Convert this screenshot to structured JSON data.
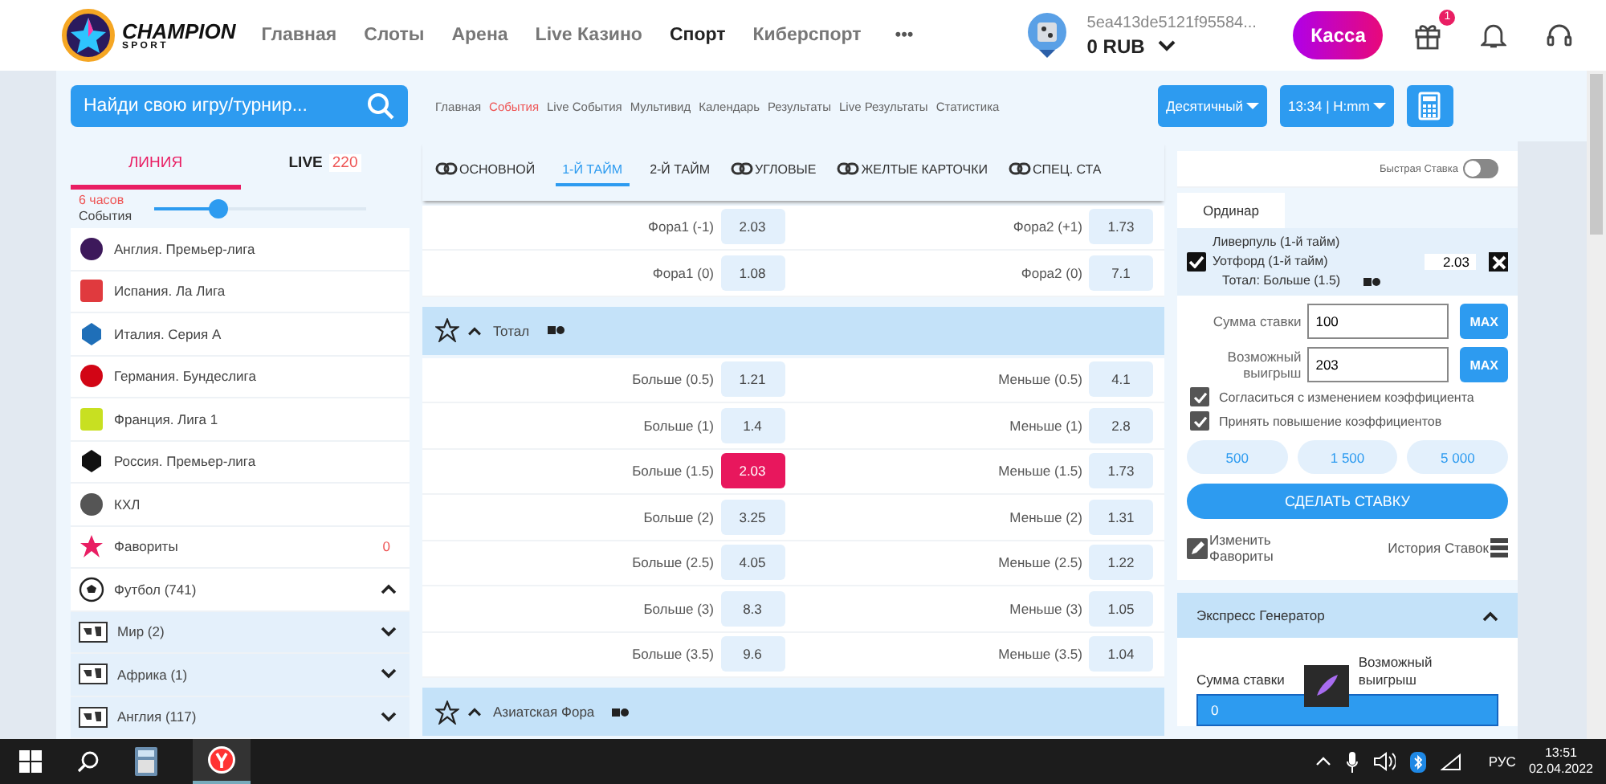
{
  "header": {
    "logo": {
      "title": "CHAMPION",
      "subtitle": "S P O R T"
    },
    "nav": [
      {
        "label": "Главная",
        "selected": false
      },
      {
        "label": "Слоты",
        "selected": false
      },
      {
        "label": "Арена",
        "selected": false
      },
      {
        "label": "Live Казино",
        "selected": false
      },
      {
        "label": "Спорт",
        "selected": true
      },
      {
        "label": "Киберспорт",
        "selected": false
      }
    ],
    "more": "•••",
    "account": {
      "id": "5ea413de5121f95584...",
      "balance": "0 RUB"
    },
    "cashier": "Касса",
    "gift_badge": "1"
  },
  "subnav": {
    "search": {
      "placeholder": "Найди свою игру/турнир..."
    },
    "breadcrumbs": [
      {
        "label": "Главная",
        "selected": false
      },
      {
        "label": "События",
        "selected": true
      },
      {
        "label": "Live События",
        "selected": false
      },
      {
        "label": "Мультивид",
        "selected": false
      },
      {
        "label": "Календарь",
        "selected": false
      },
      {
        "label": "Результаты",
        "selected": false
      },
      {
        "label": "Live Результаты",
        "selected": false
      },
      {
        "label": "Статистика",
        "selected": false
      }
    ],
    "odds_format": "Десятичный",
    "time_format": "13:34 | H:mm"
  },
  "sidebar": {
    "tabs": [
      {
        "label": "ЛИНИЯ",
        "selected": true
      },
      {
        "label": "LIVE",
        "count": "220",
        "selected": false
      }
    ],
    "filter": {
      "hours": "6 часов",
      "label": "События",
      "level": 0.3
    },
    "items": [
      {
        "kind": "league",
        "name": "Англия. Премьер-лига"
      },
      {
        "kind": "league",
        "name": "Испания. Ла Лига"
      },
      {
        "kind": "league",
        "name": "Италия. Серия А"
      },
      {
        "kind": "league",
        "name": "Германия. Бундеслига"
      },
      {
        "kind": "league",
        "name": "Франция. Лига 1"
      },
      {
        "kind": "league",
        "name": "Россия. Премьер-лига"
      },
      {
        "kind": "league",
        "name": "КХЛ"
      },
      {
        "kind": "favorites",
        "name": "Фавориты",
        "count": "0"
      },
      {
        "kind": "sport",
        "name": "Футбол (741)",
        "expanded": true,
        "children": [
          {
            "name": "Мир (2)",
            "expanded": false
          },
          {
            "name": "Африка (1)",
            "expanded": false
          },
          {
            "name": "Англия (117)",
            "expanded": false
          }
        ]
      }
    ]
  },
  "markets": {
    "tabs": [
      {
        "label": "ОСНОВНОЙ",
        "linked": true,
        "selected": false
      },
      {
        "label": "1-Й ТАЙМ",
        "linked": false,
        "selected": true
      },
      {
        "label": "2-Й ТАЙМ",
        "linked": false,
        "selected": false
      },
      {
        "label": "УГЛОВЫЕ",
        "linked": true,
        "selected": false
      },
      {
        "label": "ЖЕЛТЫЕ КАРТОЧКИ",
        "linked": true,
        "selected": false
      },
      {
        "label": "СПЕЦ. СТА",
        "linked": true,
        "selected": false
      }
    ],
    "groups": [
      {
        "rows": [
          {
            "left": {
              "label": "Фора1 (-1)",
              "odds": "2.03",
              "selected": false
            },
            "right": {
              "label": "Фора2 (+1)",
              "odds": "1.73",
              "selected": false
            }
          },
          {
            "left": {
              "label": "Фора1 (0)",
              "odds": "1.08",
              "selected": false
            },
            "right": {
              "label": "Фора2 (0)",
              "odds": "7.1",
              "selected": false
            }
          }
        ]
      },
      {
        "title": "Тотал",
        "favorite": false,
        "expanded": true,
        "rows": [
          {
            "left": {
              "label": "Больше (0.5)",
              "odds": "1.21",
              "selected": false
            },
            "right": {
              "label": "Меньше (0.5)",
              "odds": "4.1",
              "selected": false
            }
          },
          {
            "left": {
              "label": "Больше (1)",
              "odds": "1.4",
              "selected": false
            },
            "right": {
              "label": "Меньше (1)",
              "odds": "2.8",
              "selected": false
            }
          },
          {
            "left": {
              "label": "Больше (1.5)",
              "odds": "2.03",
              "selected": true
            },
            "right": {
              "label": "Меньше (1.5)",
              "odds": "1.73",
              "selected": false
            }
          },
          {
            "left": {
              "label": "Больше (2)",
              "odds": "3.25",
              "selected": false
            },
            "right": {
              "label": "Меньше (2)",
              "odds": "1.31",
              "selected": false
            }
          },
          {
            "left": {
              "label": "Больше (2.5)",
              "odds": "4.05",
              "selected": false
            },
            "right": {
              "label": "Меньше (2.5)",
              "odds": "1.22",
              "selected": false
            }
          },
          {
            "left": {
              "label": "Больше (3)",
              "odds": "8.3",
              "selected": false
            },
            "right": {
              "label": "Меньше (3)",
              "odds": "1.05",
              "selected": false
            }
          },
          {
            "left": {
              "label": "Больше (3.5)",
              "odds": "9.6",
              "selected": false
            },
            "right": {
              "label": "Меньше (3.5)",
              "odds": "1.04",
              "selected": false
            }
          }
        ]
      },
      {
        "title": "Азиатская Фора",
        "favorite": false,
        "expanded": true
      }
    ]
  },
  "betslip": {
    "quick_bet": {
      "label": "Быстрая Ставка",
      "on": false
    },
    "tabs": [
      {
        "label": "Ординар",
        "selected": true
      }
    ],
    "selection": {
      "checked": true,
      "team1": "Ливерпуль (1-й тайм)",
      "team2": "Уотфорд (1-й тайм)",
      "market": "Тотал: Больше (1.5)",
      "odds": "2.03"
    },
    "stake": {
      "label": "Сумма ставки",
      "value": "100",
      "max": "MAX"
    },
    "win": {
      "label": "Возможный выигрыш",
      "value": "203",
      "max": "MAX"
    },
    "options": [
      {
        "label": "Согласиться с изменением коэффициента",
        "checked": true
      },
      {
        "label": "Принять повышение коэффициентов",
        "checked": true
      }
    ],
    "quick_amounts": [
      "500",
      "1 500",
      "5 000"
    ],
    "place_bet": "СДЕЛАТЬ СТАВКУ",
    "edit_favorites": "Изменить Фавориты",
    "history": "История Ставок",
    "express": {
      "title": "Экспресс Генератор",
      "expanded": true,
      "stake_label": "Сумма ставки",
      "win_label": "Возможный выигрыш",
      "stake_value": "0"
    }
  },
  "taskbar": {
    "language": "РУС",
    "time": "13:51",
    "date": "02.04.2022"
  }
}
